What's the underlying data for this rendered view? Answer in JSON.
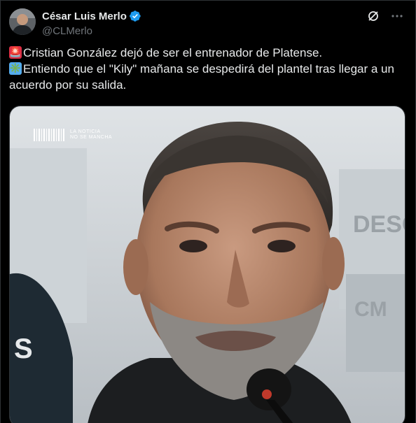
{
  "author": {
    "display_name": "César Luis Merlo",
    "handle": "@CLMerlo",
    "verified": true
  },
  "icons": {
    "verified": "verified-badge-icon",
    "grok": "grok-icon",
    "more": "more-options-icon",
    "siren": "police-light-emoji",
    "asterisk": "eight-spoked-asterisk-emoji"
  },
  "tweet": {
    "line1_emoji": "🚨",
    "line1_text": "Cristian González dejó de ser el entrenador de Platense.",
    "line2_emoji": "✳️",
    "line2_text": "Entiendo que el \"Kily\" mañana se despedirá del plantel tras llegar a un acuerdo por su salida."
  },
  "media": {
    "watermark_line1": "LA NOTICIA",
    "watermark_line2": "NO SE MANCHA"
  },
  "colors": {
    "background": "#000000",
    "text": "#e7e9ea",
    "secondary_text": "#71767b",
    "verified_blue": "#1d9bf0",
    "border": "#2f3336"
  }
}
